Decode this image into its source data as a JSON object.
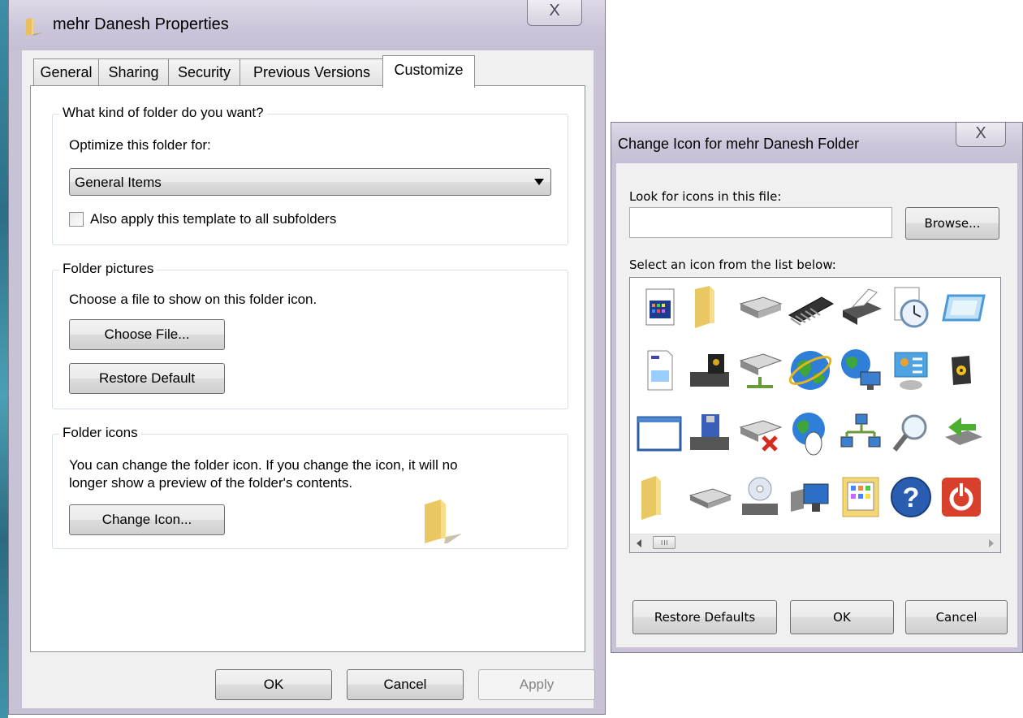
{
  "properties_window": {
    "title": "mehr Danesh Properties",
    "close_glyph": "X",
    "tabs": [
      {
        "label": "General"
      },
      {
        "label": "Sharing"
      },
      {
        "label": "Security"
      },
      {
        "label": "Previous Versions"
      },
      {
        "label": "Customize",
        "active": true
      }
    ],
    "folder_kind": {
      "group_title": "What kind of folder do you want?",
      "optimize_label": "Optimize this folder for:",
      "selected_option": "General Items",
      "apply_subfolders_label": "Also apply this template to all subfolders",
      "apply_subfolders_checked": false
    },
    "folder_pictures": {
      "group_title": "Folder pictures",
      "description": "Choose a file to show on this folder icon.",
      "choose_file_label": "Choose File...",
      "restore_default_label": "Restore Default"
    },
    "folder_icons": {
      "group_title": "Folder icons",
      "description_line1": "You can change the folder icon. If you change the icon, it will no",
      "description_line2": "longer show a preview of the folder's contents.",
      "change_icon_label": "Change Icon...",
      "preview_icon": "folder-icon"
    },
    "buttons": {
      "ok": "OK",
      "cancel": "Cancel",
      "apply": "Apply",
      "apply_enabled": false
    }
  },
  "change_icon_window": {
    "title": "Change Icon for mehr Danesh Folder",
    "close_glyph": "X",
    "look_label": "Look for icons in this file:",
    "file_path_value": "",
    "browse_label": "Browse...",
    "select_label": "Select an icon from the list below:",
    "icons": [
      "application-window-icon",
      "folder-icon",
      "removable-drive-icon",
      "memory-chip-icon",
      "printer-icon",
      "clock-icon",
      "monitor-frame-icon",
      "document-icon",
      "locked-drive-icon",
      "network-drive-icon",
      "internet-globe-icon",
      "network-globe-icon",
      "control-panel-icon",
      "cd-speaker-icon",
      "blank-window-icon",
      "floppy-drive-icon",
      "disconnected-drive-icon",
      "globe-mouse-icon",
      "network-computers-icon",
      "magnifier-icon",
      "green-arrow-drive-icon",
      "folder-icon",
      "hard-drive-icon",
      "cd-drive-icon",
      "monitors-icon",
      "control-panel-folder-icon",
      "help-icon",
      "power-icon"
    ],
    "buttons": {
      "restore_defaults": "Restore Defaults",
      "ok": "OK",
      "cancel": "Cancel"
    },
    "colors": {
      "title_bar": "#ccc4d9",
      "folder_yellow": "#f4d675",
      "help_blue": "#2a5db0",
      "power_red": "#d9402b"
    }
  }
}
